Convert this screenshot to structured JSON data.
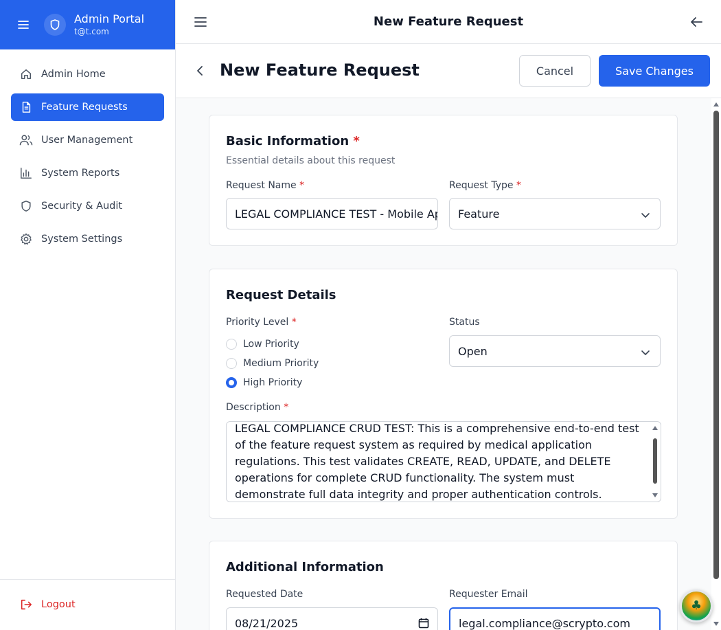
{
  "app": {
    "title": "Admin Portal",
    "user_email": "t@t.com"
  },
  "sidebar": {
    "items": [
      {
        "label": "Admin Home",
        "icon": "home-icon"
      },
      {
        "label": "Feature Requests",
        "icon": "document-icon",
        "active": true
      },
      {
        "label": "User Management",
        "icon": "users-icon"
      },
      {
        "label": "System Reports",
        "icon": "bar-chart-icon"
      },
      {
        "label": "Security & Audit",
        "icon": "shield-icon"
      },
      {
        "label": "System Settings",
        "icon": "gear-icon"
      }
    ],
    "logout_label": "Logout"
  },
  "topbar": {
    "title": "New Feature Request"
  },
  "header": {
    "title": "New Feature Request",
    "cancel_label": "Cancel",
    "save_label": "Save Changes"
  },
  "basic": {
    "title": "Basic Information",
    "subtitle": "Essential details about this request",
    "name_label": "Request Name",
    "name_value": "LEGAL COMPLIANCE TEST - Mobile App",
    "type_label": "Request Type",
    "type_value": "Feature"
  },
  "details": {
    "title": "Request Details",
    "priority_label": "Priority Level",
    "priorities": [
      {
        "label": "Low Priority",
        "checked": false
      },
      {
        "label": "Medium Priority",
        "checked": false
      },
      {
        "label": "High Priority",
        "checked": true
      }
    ],
    "status_label": "Status",
    "status_value": "Open",
    "description_label": "Description",
    "description_value": "LEGAL COMPLIANCE CRUD TEST: This is a comprehensive end-to-end test of the feature request system as required by medical application regulations. This test validates CREATE, READ, UPDATE, and DELETE operations for complete CRUD functionality. The system must demonstrate full data integrity and proper authentication controls."
  },
  "additional": {
    "title": "Additional Information",
    "date_label": "Requested Date",
    "date_value": "08/21/2025",
    "email_label": "Requester Email",
    "email_value": "legal.compliance@scrypto.com"
  },
  "colors": {
    "accent": "#2563eb",
    "required": "#dc2626",
    "logout": "#dc2626"
  }
}
